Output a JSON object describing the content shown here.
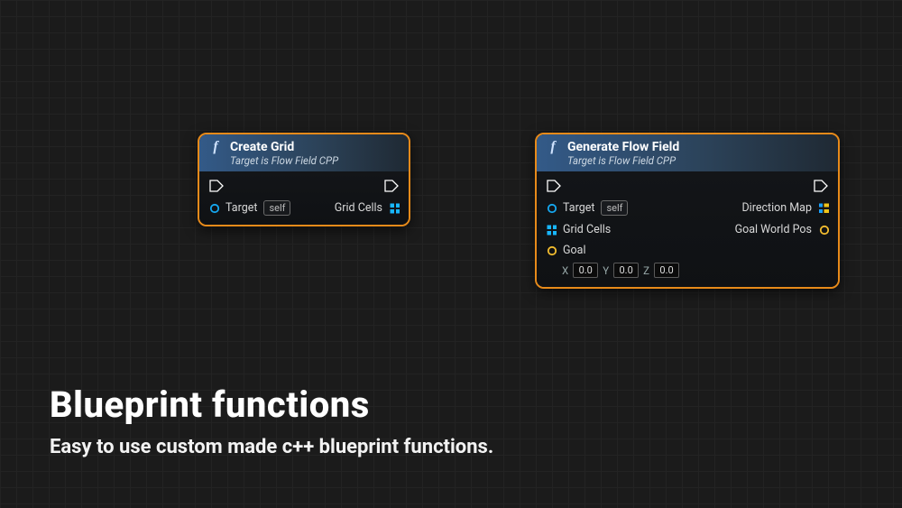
{
  "caption": {
    "title": "Blueprint functions",
    "subtitle": "Easy to use custom made c++ blueprint functions."
  },
  "nodes": {
    "create_grid": {
      "title": "Create Grid",
      "subtitle": "Target is Flow Field CPP",
      "target_label": "Target",
      "target_value": "self",
      "grid_cells_label": "Grid Cells"
    },
    "gen_flow": {
      "title": "Generate Flow Field",
      "subtitle": "Target is Flow Field CPP",
      "target_label": "Target",
      "target_value": "self",
      "grid_cells_label": "Grid Cells",
      "goal_label": "Goal",
      "goal_x_label": "X",
      "goal_y_label": "Y",
      "goal_z_label": "Z",
      "goal_x": "0.0",
      "goal_y": "0.0",
      "goal_z": "0.0",
      "direction_map_label": "Direction Map",
      "goal_world_pos_label": "Goal World Pos"
    }
  }
}
